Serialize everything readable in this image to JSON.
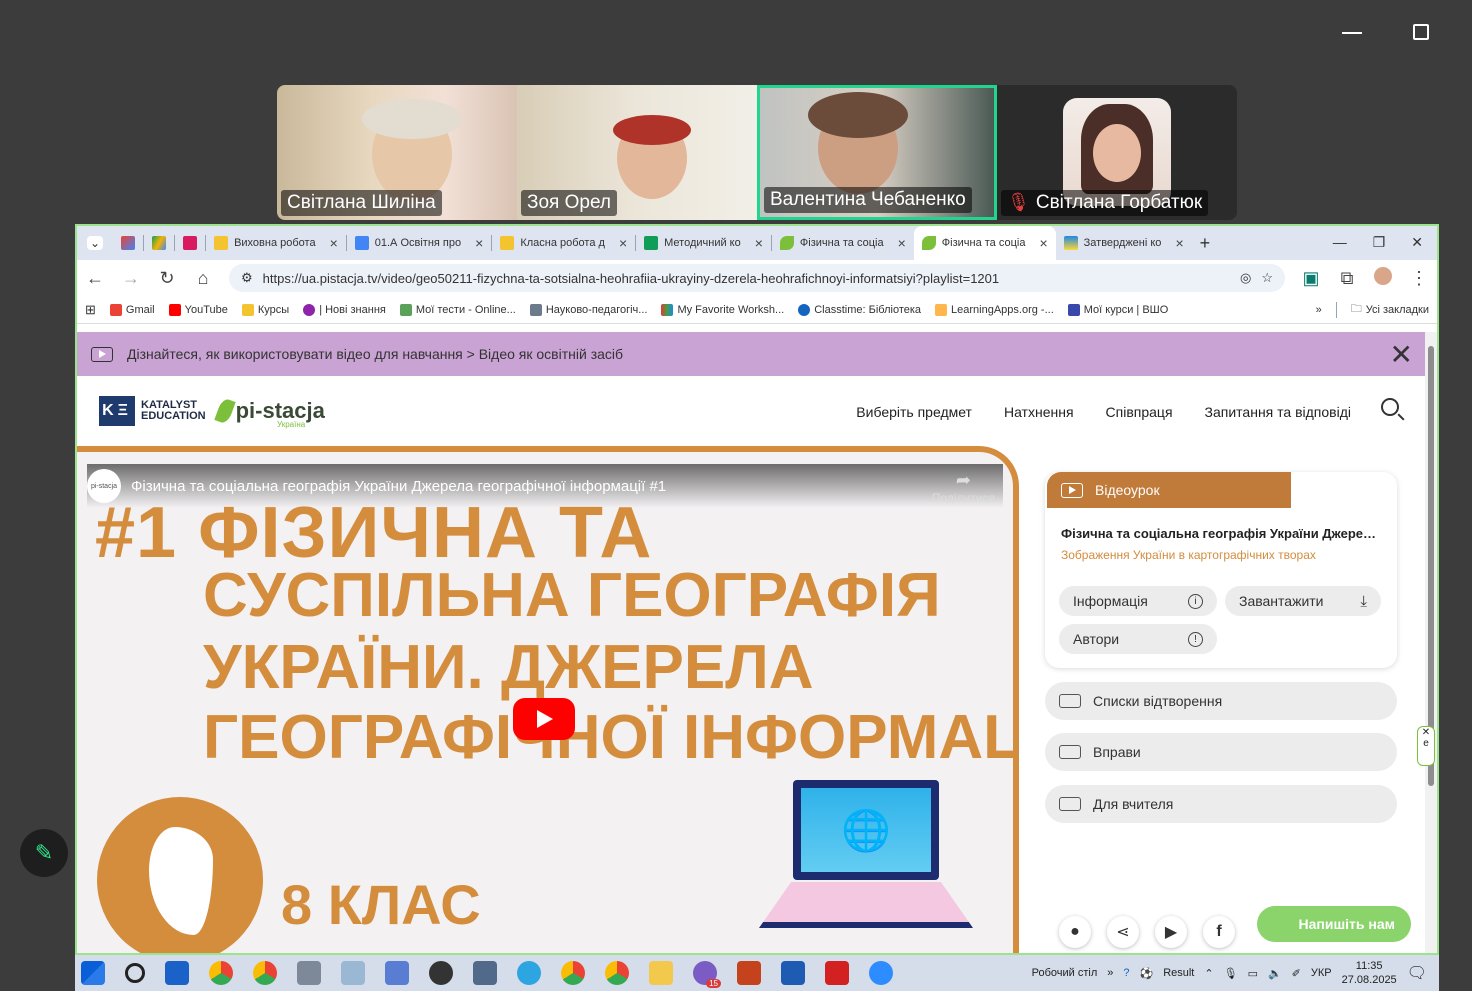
{
  "zoom": {
    "participants": [
      {
        "name": "Світлана Шиліна"
      },
      {
        "name": "Зоя Орел"
      },
      {
        "name": "Валентина Чебаненко"
      },
      {
        "name": "Світлана Горбатюк"
      }
    ]
  },
  "tabs": [
    {
      "label": "Виховна робота"
    },
    {
      "label": "01.А Освітня про"
    },
    {
      "label": "Класна робота д"
    },
    {
      "label": "Методичний ко"
    },
    {
      "label": "Фізична та соціа"
    },
    {
      "label": "Фізична та соціа"
    },
    {
      "label": "Затверджені ко"
    }
  ],
  "url": "https://ua.pistacja.tv/video/geo50211-fizychna-ta-sotsialna-heohrafiia-ukrayiny-dzerela-heohrafichnoyi-informatsiyi?playlist=1201",
  "bookmarks": [
    {
      "label": "Gmail"
    },
    {
      "label": "YouTube"
    },
    {
      "label": "Курсы"
    },
    {
      "label": "| Нові знання"
    },
    {
      "label": "Мої тести - Online..."
    },
    {
      "label": "Науково-педагогіч..."
    },
    {
      "label": "My Favorite Worksh..."
    },
    {
      "label": "Classtime: Бібліотека"
    },
    {
      "label": "LearningApps.org -..."
    },
    {
      "label": "Мої курси | ВШО"
    },
    {
      "label": "Усі закладки"
    }
  ],
  "banner": {
    "text": "Дізнайтеся, як використовувати відео для навчання > Відео як освітній засіб"
  },
  "site": {
    "logo_ke_1": "KATALYST",
    "logo_ke_2": "EDUCATION",
    "logo_pista": "pi-stacja",
    "logo_pista_sub": "Україна",
    "menu": [
      "Виберіть предмет",
      "Натхнення",
      "Співпраця",
      "Запитання та відповіді"
    ]
  },
  "video": {
    "channel_logo": "pi-stacja",
    "title": "Фізична та соціальна географія України Джерела географічної інформації #1",
    "share": "Поділитися",
    "line1": "#1 ФІЗИЧНА ТА",
    "line2": "СУСПІЛЬНА ГЕОГРАФІЯ",
    "line3": "УКРАЇНИ. ДЖЕРЕЛА",
    "line4": "ГЕОГРАФІЧНОЇ ІНФОРМАЦІЇ",
    "grade": "8 КЛАС"
  },
  "panel": {
    "head": "Відеоурок",
    "title": "Фізична та соціальна географія України Джерел...",
    "subtitle": "Зображення України в картографічних творах",
    "info": "Інформація",
    "download": "Завантажити",
    "authors": "Автори"
  },
  "sections": [
    "Списки відтворення",
    "Вправи",
    "Для вчителя"
  ],
  "chat_button": "Напишіть нам",
  "taskbar": {
    "desktop": "Робочий стіл",
    "result": "Result",
    "lang": "УКР",
    "time": "11:35",
    "date": "27.08.2025",
    "badge": "15"
  }
}
